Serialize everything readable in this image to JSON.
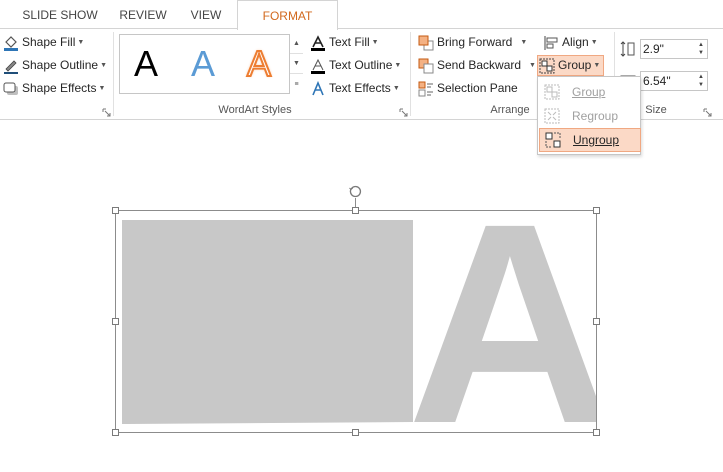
{
  "tabs": [
    {
      "label": "SLIDE SHOW"
    },
    {
      "label": "REVIEW"
    },
    {
      "label": "VIEW"
    },
    {
      "label": "FORMAT",
      "active": true
    }
  ],
  "shape_styles": {
    "shape_fill": "Shape Fill",
    "shape_outline": "Shape Outline",
    "shape_effects": "Shape Effects"
  },
  "wordart": {
    "samples": [
      {
        "letter": "A",
        "style": "black"
      },
      {
        "letter": "A",
        "style": "blue"
      },
      {
        "letter": "A",
        "style": "orange-outline"
      }
    ],
    "text_fill": "Text Fill",
    "text_outline": "Text Outline",
    "text_effects": "Text Effects",
    "group_label": "WordArt Styles"
  },
  "arrange": {
    "bring_forward": "Bring Forward",
    "send_backward": "Send Backward",
    "selection_pane": "Selection Pane",
    "align": "Align",
    "group": "Group",
    "group_label": "Arrange"
  },
  "size": {
    "height": "2.9\"",
    "width": "6.54\"",
    "group_label": "Size"
  },
  "group_menu": {
    "items": [
      {
        "label": "Group",
        "state": "disabled"
      },
      {
        "label": "Regroup",
        "state": "disabled"
      },
      {
        "label": "Ungroup",
        "state": "highlighted"
      }
    ]
  },
  "canvas": {
    "glyph": "A",
    "glyph_color": "#c8c8c8"
  },
  "colors": {
    "accent": "#d2691e",
    "highlight": "#fbd9c6",
    "highlight_border": "#f0a882"
  }
}
